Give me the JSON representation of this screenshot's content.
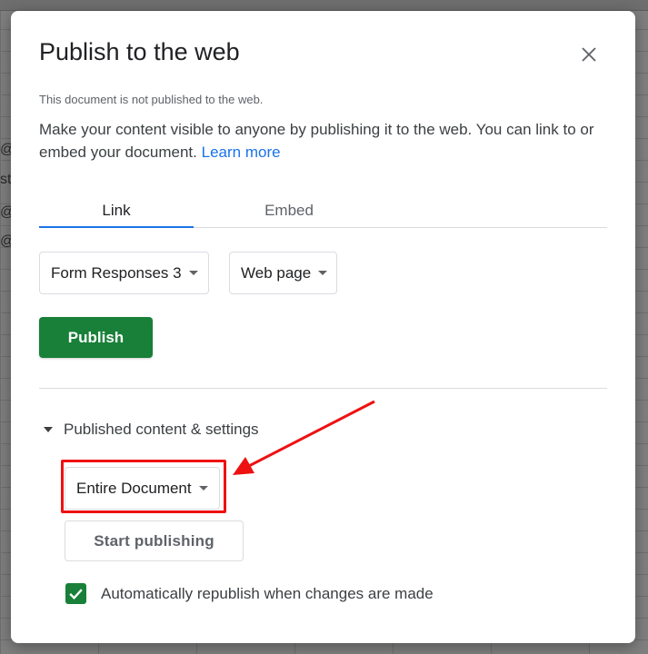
{
  "background": {
    "cell_fragments": [
      "@g",
      "st",
      "@g",
      "@g"
    ]
  },
  "dialog": {
    "title": "Publish to the web",
    "close_icon": "close-icon",
    "status_note": "This document is not published to the web.",
    "description": "Make your content visible to anyone by publishing it to the web. You can link to or embed your document.",
    "learn_more": "Learn more",
    "tabs": [
      {
        "label": "Link",
        "selected": true
      },
      {
        "label": "Embed",
        "selected": false
      }
    ],
    "sheet_select": {
      "value": "Form Responses 3"
    },
    "format_select": {
      "value": "Web page"
    },
    "publish_label": "Publish",
    "section_label": "Published content & settings",
    "range_select": {
      "value": "Entire Document"
    },
    "start_publishing_label": "Start publishing",
    "auto_republish": {
      "label": "Automatically republish when changes are made",
      "checked": true
    }
  },
  "colors": {
    "accent": "#1a73e8",
    "publish_green": "#188038",
    "annotation_red": "#ee1111"
  }
}
